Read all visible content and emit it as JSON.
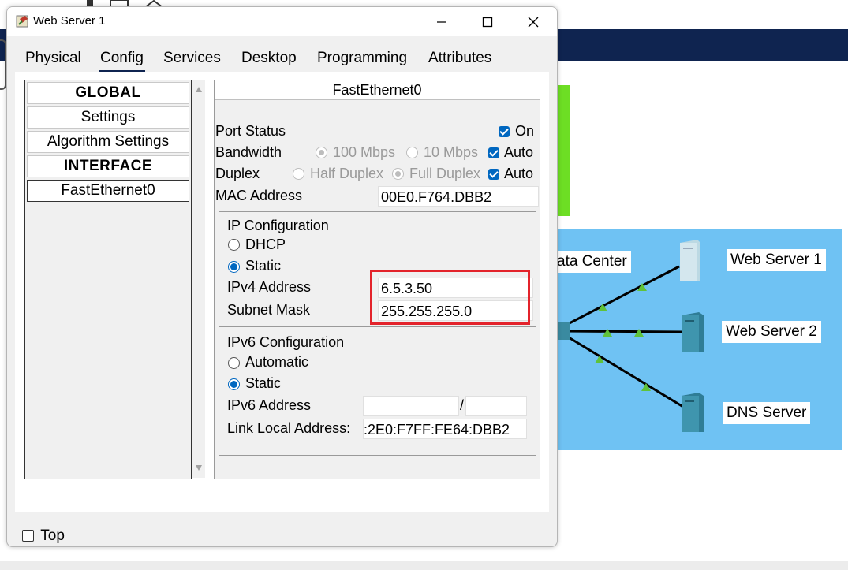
{
  "window": {
    "title": "Web Server 1",
    "controls": {
      "minimize": "minimize",
      "maximize": "maximize",
      "close": "close"
    }
  },
  "tabs": [
    "Physical",
    "Config",
    "Services",
    "Desktop",
    "Programming",
    "Attributes"
  ],
  "active_tab": "Config",
  "sidebar": {
    "items": [
      {
        "label": "GLOBAL",
        "bold": true
      },
      {
        "label": "Settings",
        "bold": false
      },
      {
        "label": "Algorithm Settings",
        "bold": false
      },
      {
        "label": "INTERFACE",
        "bold": true
      },
      {
        "label": "FastEthernet0",
        "bold": false,
        "selected": true
      }
    ]
  },
  "panel": {
    "title": "FastEthernet0",
    "port_status": {
      "label": "Port Status",
      "on_label": "On",
      "checked": true
    },
    "bandwidth": {
      "label": "Bandwidth",
      "opt1": "100 Mbps",
      "opt2": "10 Mbps",
      "auto_label": "Auto"
    },
    "duplex": {
      "label": "Duplex",
      "opt1": "Half Duplex",
      "opt2": "Full Duplex",
      "auto_label": "Auto"
    },
    "mac": {
      "label": "MAC Address",
      "value": "00E0.F764.DBB2"
    },
    "ipv4": {
      "heading": "IP Configuration",
      "dhcp_label": "DHCP",
      "static_label": "Static",
      "address_label": "IPv4 Address",
      "address_value": "6.5.3.50",
      "mask_label": "Subnet Mask",
      "mask_value": "255.255.255.0"
    },
    "ipv6": {
      "heading": "IPv6 Configuration",
      "auto_label": "Automatic",
      "static_label": "Static",
      "address_label": "IPv6 Address",
      "address_value": "",
      "prefix_sep": "/",
      "prefix_value": "",
      "link_local_label": "Link Local Address:",
      "link_local_value": ":2E0:F7FF:FE64:DBB2"
    }
  },
  "footer": {
    "top_label": "Top",
    "top_checked": false
  },
  "background": {
    "cloud_label": "ata Center",
    "servers": [
      "Web Server 1",
      "Web Server 2",
      "DNS Server"
    ]
  },
  "colors": {
    "nav_band": "#0f2450",
    "cloud": "#6fc2f3",
    "green_box": "#6dde24",
    "highlight": "#e3232b",
    "accent": "#0067c0"
  }
}
